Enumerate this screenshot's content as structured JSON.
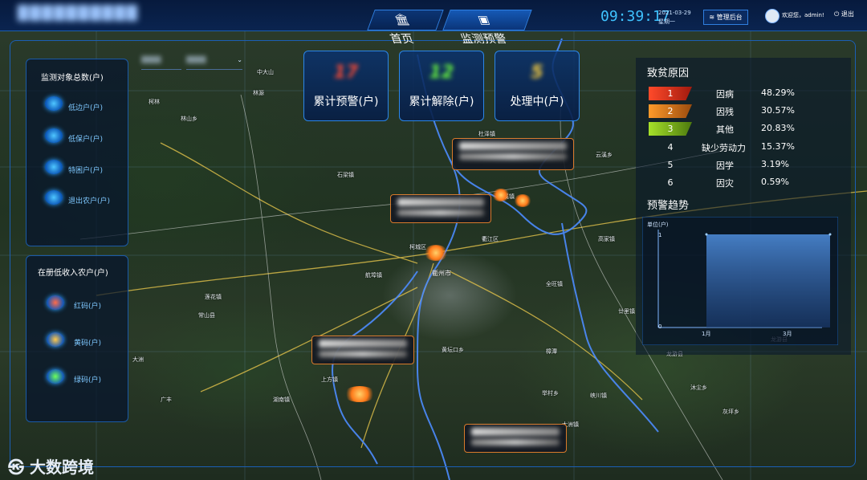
{
  "app": {
    "title": "██████████"
  },
  "nav": {
    "home_label": "首页",
    "monitor_label": "监测预警"
  },
  "header": {
    "time": "09:39:17",
    "date": "2021-03-29",
    "weekday": "星期一",
    "admin_button": "管理后台",
    "welcome": "欢迎您，admin!",
    "logout": "退出"
  },
  "left_panel": {
    "title": "监测对象总数(户)",
    "items": [
      {
        "label": "低边户(户)",
        "icon": "user-group-icon"
      },
      {
        "label": "低保户(户)",
        "icon": "user-group-icon"
      },
      {
        "label": "特困户(户)",
        "icon": "user-group-icon"
      },
      {
        "label": "退出农户(户)",
        "icon": "user-group-icon"
      }
    ]
  },
  "low_income_panel": {
    "title": "在册低收入农户(户)",
    "items": [
      {
        "label": "红码(户)",
        "icon": "red-code-icon",
        "color": "#ff3b2f"
      },
      {
        "label": "黄码(户)",
        "icon": "yellow-code-icon",
        "color": "#f0a020"
      },
      {
        "label": "绿码(户)",
        "icon": "green-code-icon",
        "color": "#3ac44a"
      }
    ]
  },
  "stats": [
    {
      "label": "累计预警(户)",
      "value": "17",
      "color": "#ff3b2f"
    },
    {
      "label": "累计解除(户)",
      "value": "12",
      "color": "#6cff3d"
    },
    {
      "label": "处理中(户)",
      "value": "5",
      "color": "#ffd23f"
    }
  ],
  "causes": {
    "title": "致贫原因",
    "rows": [
      {
        "rank": "1",
        "name": "因病",
        "pct": "48.29%",
        "color": "#d9311e"
      },
      {
        "rank": "2",
        "name": "因残",
        "pct": "30.57%",
        "color": "#e0791a"
      },
      {
        "rank": "3",
        "name": "其他",
        "pct": "20.83%",
        "color": "#8cc21f"
      },
      {
        "rank": "4",
        "name": "缺少劳动力",
        "pct": "15.37%",
        "color": ""
      },
      {
        "rank": "5",
        "name": "因学",
        "pct": "3.19%",
        "color": ""
      },
      {
        "rank": "6",
        "name": "因灾",
        "pct": "0.59%",
        "color": ""
      }
    ]
  },
  "trend": {
    "title": "预警趋势",
    "unit": "单位(户)",
    "y_tick_top": "1",
    "y_tick_bottom": "0",
    "x_start": "1月",
    "x_end": "3月"
  },
  "chart_data": {
    "type": "area",
    "x": [
      "1月",
      "3月"
    ],
    "series": [
      {
        "values": [
          1,
          1
        ]
      }
    ],
    "ylim": [
      0,
      1
    ],
    "ylabel": "单位(户)",
    "grid": false
  },
  "map": {
    "city_label": "衢州市",
    "places": [
      "中大山",
      "林源",
      "林山乡",
      "石梁镇",
      "航埠镇",
      "杜泽镇",
      "云溪乡",
      "莲花镇",
      "龙游县",
      "常山县",
      "龙游县",
      "高家镇",
      "全旺镇",
      "柯城区",
      "衢江区",
      "黄坛口乡",
      "上方镇",
      "湖南镇",
      "举村乡",
      "峡川镇",
      "大洲镇",
      "沐尘乡",
      "灰坪乡",
      "樟潭",
      "廿里镇",
      "后溪镇"
    ],
    "markers": [
      "marker-1",
      "marker-2",
      "marker-3",
      "marker-4"
    ]
  },
  "watermark": "大数跨境"
}
